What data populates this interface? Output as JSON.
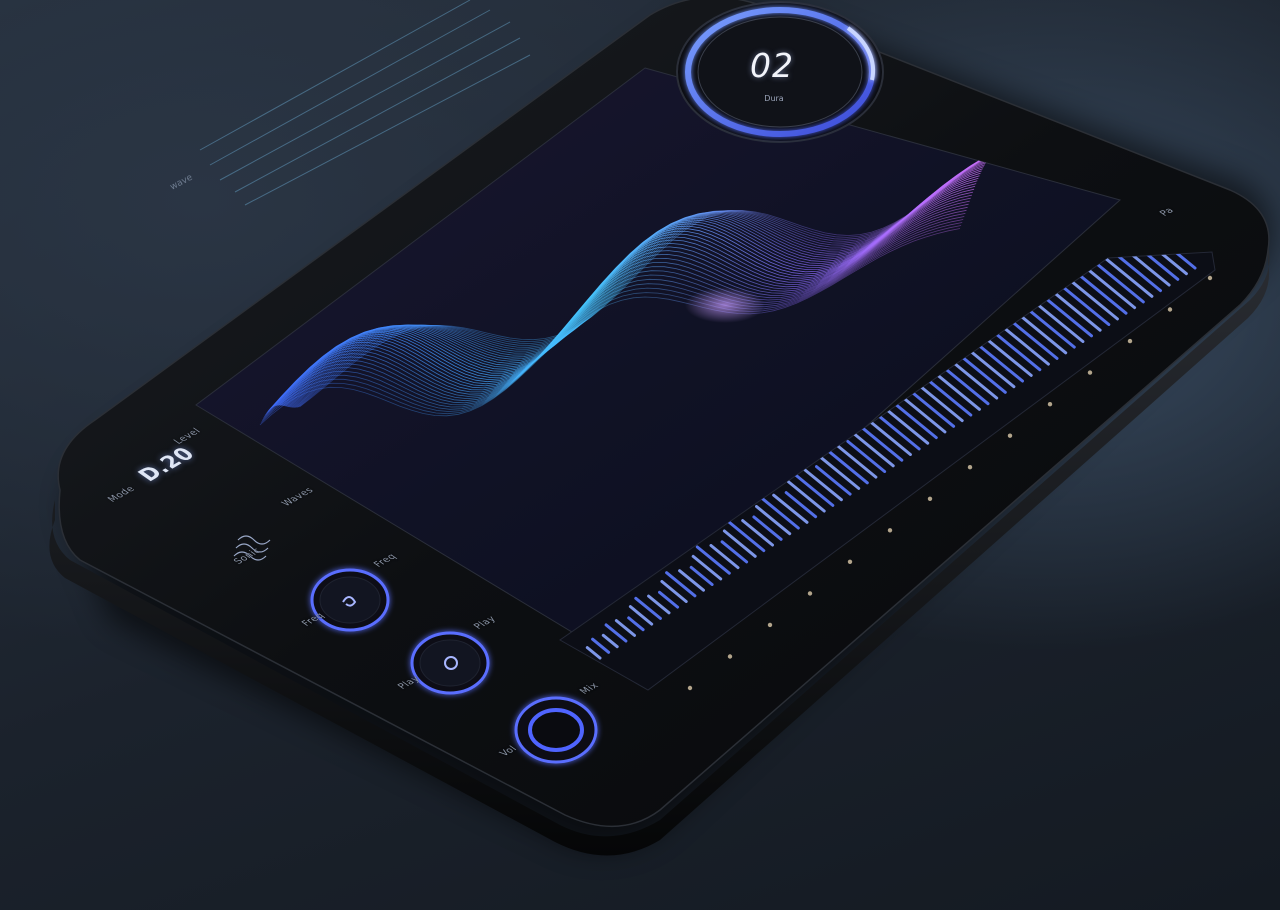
{
  "timer": {
    "value": "02",
    "unit": "Dura"
  },
  "readout": {
    "value": "D.20",
    "label": "Level"
  },
  "labels": {
    "top_right": "Pa",
    "left_mode": "Mode",
    "btn_waves": "Waves",
    "btn_one": "Freq",
    "btn_two": "Play",
    "btn_three": "Mix",
    "btn_four": "Vol",
    "panel_note": "Sonic"
  },
  "palette": {
    "accent_blue": "#4a66ff",
    "accent_purple": "#c06bff",
    "accent_cyan": "#46c7ff",
    "device_body": "#0f1114",
    "screen_bg": "#111220"
  },
  "icons": {
    "waves": "waves-icon",
    "btn_one": "spiral-icon",
    "btn_two": "swirl-icon",
    "btn_three": "ring-icon"
  },
  "spectrum": {
    "type": "bar",
    "values": [
      0.28,
      0.35,
      0.3,
      0.42,
      0.38,
      0.3,
      0.44,
      0.5,
      0.41,
      0.36,
      0.48,
      0.55,
      0.46,
      0.4,
      0.52,
      0.6,
      0.5,
      0.45,
      0.56,
      0.62,
      0.53,
      0.48,
      0.58,
      0.66,
      0.57,
      0.5,
      0.6,
      0.7,
      0.6,
      0.55,
      0.64,
      0.72,
      0.62,
      0.58,
      0.67,
      0.76,
      0.65,
      0.6,
      0.7,
      0.78,
      0.69,
      0.63,
      0.73,
      0.82,
      0.7,
      0.66,
      0.76,
      0.85,
      0.74,
      0.7,
      0.8,
      0.88,
      0.77,
      0.72,
      0.83,
      0.9,
      0.8,
      0.76,
      0.86,
      0.93,
      0.82,
      0.78,
      0.88,
      0.95,
      0.85,
      0.8,
      0.9,
      0.97,
      0.87,
      0.83
    ]
  }
}
